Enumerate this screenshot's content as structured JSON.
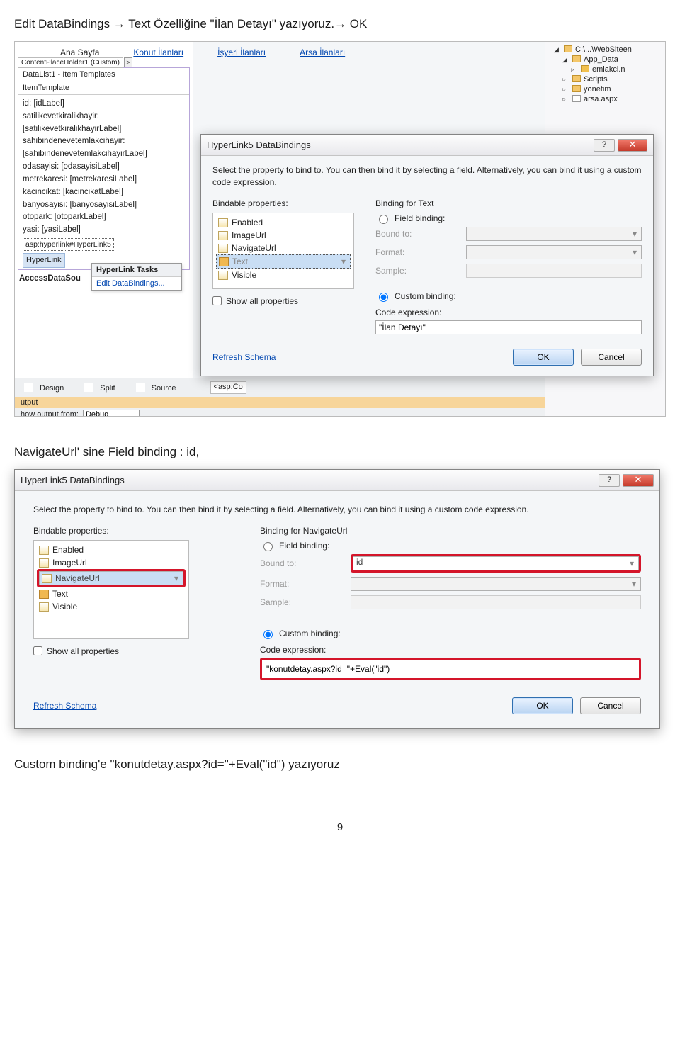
{
  "doc": {
    "line1": "Edit DataBindings → Text Özelliğine \"İlan Detayı\" yazıyoruz.→ OK",
    "line2": "NavigateUrl' sine Field binding : id,",
    "line3": "Custom binding'e \"konutdetay.aspx?id=\"+Eval(\"id\") yazıyoruz",
    "pagenum": "9"
  },
  "vs": {
    "tabs": {
      "t1": "Ana Sayfa",
      "t2": "Konut İlanları",
      "t3": "İşyeri İlanları",
      "t4": "Arsa İlanları"
    },
    "cphBadge": "ContentPlaceHolder1 (Custom)",
    "cphBtn": ">",
    "datalist": {
      "title": "DataList1 - Item Templates",
      "section": "ItemTemplate",
      "rows": [
        "id: [idLabel]",
        "satilikevetkiralikhayir:",
        "[satilikevetkiralikhayirLabel]",
        "sahibindenevetemlakcihayir:",
        "[sahibindenevetemlakcihayirLabel]",
        "odasayisi: [odasayisiLabel]",
        "metrekaresi: [metrekaresiLabel]",
        "kacincikat: [kacincikatLabel]",
        "banyosayisi: [banyosayisiLabel]",
        "otopark: [otoparkLabel]",
        "yasi: [yasiLabel]"
      ],
      "aspsel": "asp:hyperlink#HyperLink5",
      "hlinksel": "HyperLink",
      "ads": "AccessDataSou"
    },
    "smarttag": {
      "title": "HyperLink Tasks",
      "link": "Edit DataBindings..."
    },
    "viewbar": {
      "design": "Design",
      "split": "Split",
      "source": "Source",
      "crumb": "<asp:Co"
    },
    "outputTab": "utput",
    "outputLbl": "how output from:",
    "outputVal": "Debug",
    "tree": [
      {
        "label": "C:\\...\\WebSiteen",
        "open": true,
        "cls": "folder"
      },
      {
        "label": "App_Data",
        "open": true,
        "cls": "folder",
        "indent": 1
      },
      {
        "label": "emlakci.n",
        "cls": "file",
        "indent": 2
      },
      {
        "label": "Scripts",
        "cls": "folder",
        "indent": 1
      },
      {
        "label": "yonetim",
        "cls": "folder",
        "indent": 1
      },
      {
        "label": "arsa.aspx",
        "cls": "file",
        "indent": 1
      }
    ]
  },
  "dlg1": {
    "title": "HyperLink5 DataBindings",
    "intro": "Select the property to bind to. You can then bind it by selecting a field. Alternatively, you can bind it using a custom code expression.",
    "lblBindable": "Bindable properties:",
    "lblBindingFor": "Binding for Text",
    "props": {
      "p1": "Enabled",
      "p2": "ImageUrl",
      "p3": "NavigateUrl",
      "p4": "Text",
      "p5": "Visible"
    },
    "showAll": "Show all properties",
    "fieldBinding": "Field binding:",
    "boundTo": "Bound to:",
    "format": "Format:",
    "sample": "Sample:",
    "custom": "Custom binding:",
    "codeExpr": "Code expression:",
    "codeVal": "\"İlan Detayı\"",
    "refresh": "Refresh Schema",
    "ok": "OK",
    "cancel": "Cancel",
    "help": "?",
    "close": "✕"
  },
  "dlg2": {
    "title": "HyperLink5 DataBindings",
    "intro": "Select the property to bind to. You can then bind it by selecting a field. Alternatively, you can bind it using a custom code expression.",
    "lblBindable": "Bindable properties:",
    "lblBindingFor": "Binding for NavigateUrl",
    "props": {
      "p1": "Enabled",
      "p2": "ImageUrl",
      "p3": "NavigateUrl",
      "p4": "Text",
      "p5": "Visible"
    },
    "showAll": "Show all properties",
    "fieldBinding": "Field binding:",
    "boundTo": "Bound to:",
    "boundToVal": "id",
    "format": "Format:",
    "sample": "Sample:",
    "custom": "Custom binding:",
    "codeExpr": "Code expression:",
    "codeVal": "\"konutdetay.aspx?id=\"+Eval(\"id\")",
    "refresh": "Refresh Schema",
    "ok": "OK",
    "cancel": "Cancel",
    "help": "?",
    "close": "✕"
  }
}
